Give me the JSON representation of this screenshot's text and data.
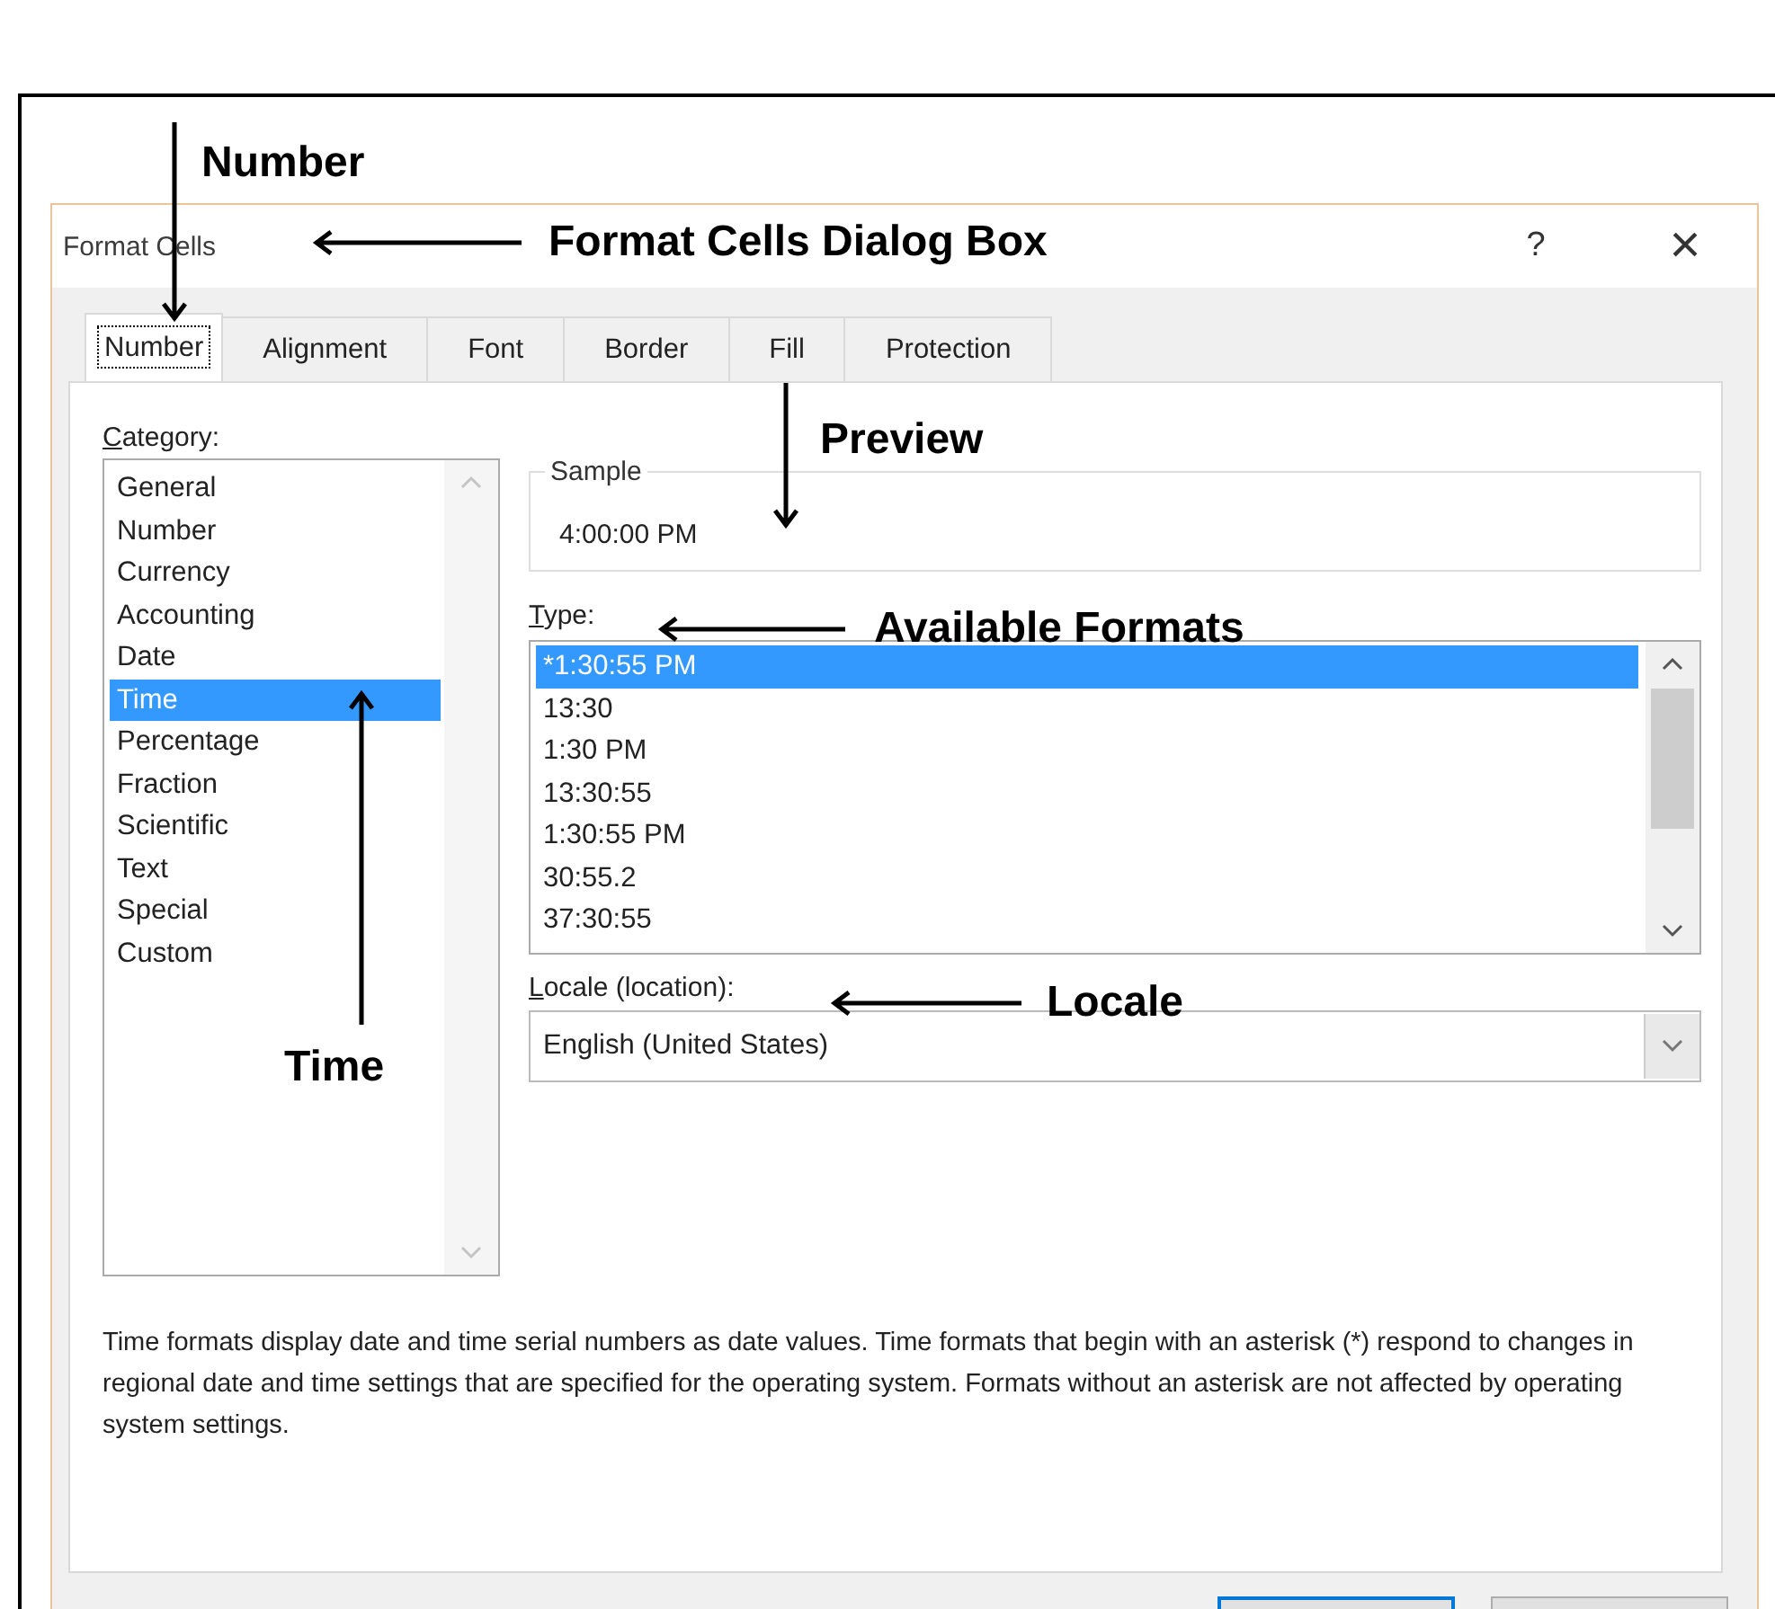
{
  "window": {
    "title": "Format Cells",
    "help": "?",
    "close": "×"
  },
  "tabs": [
    {
      "label": "Number",
      "selected": true
    },
    {
      "label": "Alignment",
      "selected": false
    },
    {
      "label": "Font",
      "selected": false
    },
    {
      "label": "Border",
      "selected": false
    },
    {
      "label": "Fill",
      "selected": false
    },
    {
      "label": "Protection",
      "selected": false
    }
  ],
  "category": {
    "label": "Category:",
    "items": [
      {
        "label": "General",
        "selected": false
      },
      {
        "label": "Number",
        "selected": false
      },
      {
        "label": "Currency",
        "selected": false
      },
      {
        "label": "Accounting",
        "selected": false
      },
      {
        "label": "Date",
        "selected": false
      },
      {
        "label": "Time",
        "selected": true
      },
      {
        "label": "Percentage",
        "selected": false
      },
      {
        "label": "Fraction",
        "selected": false
      },
      {
        "label": "Scientific",
        "selected": false
      },
      {
        "label": "Text",
        "selected": false
      },
      {
        "label": "Special",
        "selected": false
      },
      {
        "label": "Custom",
        "selected": false
      }
    ]
  },
  "sample": {
    "label": "Sample",
    "value": "4:00:00 PM"
  },
  "type": {
    "label": "Type:",
    "items": [
      {
        "label": "*1:30:55 PM",
        "selected": true
      },
      {
        "label": "13:30",
        "selected": false
      },
      {
        "label": "1:30 PM",
        "selected": false
      },
      {
        "label": "13:30:55",
        "selected": false
      },
      {
        "label": "1:30:55 PM",
        "selected": false
      },
      {
        "label": "30:55.2",
        "selected": false
      },
      {
        "label": "37:30:55",
        "selected": false
      }
    ]
  },
  "locale": {
    "label": "Locale (location):",
    "value": "English (United States)"
  },
  "description": "Time formats display date and time serial numbers as date values.  Time formats that begin with an asterisk (*) respond to changes in regional date and time settings that are specified for the operating system. Formats without an asterisk are not affected by operating system settings.",
  "buttons": [
    {
      "default": true
    },
    {
      "default": false
    }
  ],
  "annotations": [
    {
      "text": "Number",
      "kind": "down"
    },
    {
      "text": "Format Cells Dialog Box",
      "kind": "left"
    },
    {
      "text": "Preview",
      "kind": "down"
    },
    {
      "text": "Available Formats",
      "kind": "left"
    },
    {
      "text": "Locale",
      "kind": "left"
    },
    {
      "text": "Time",
      "kind": "up"
    }
  ]
}
